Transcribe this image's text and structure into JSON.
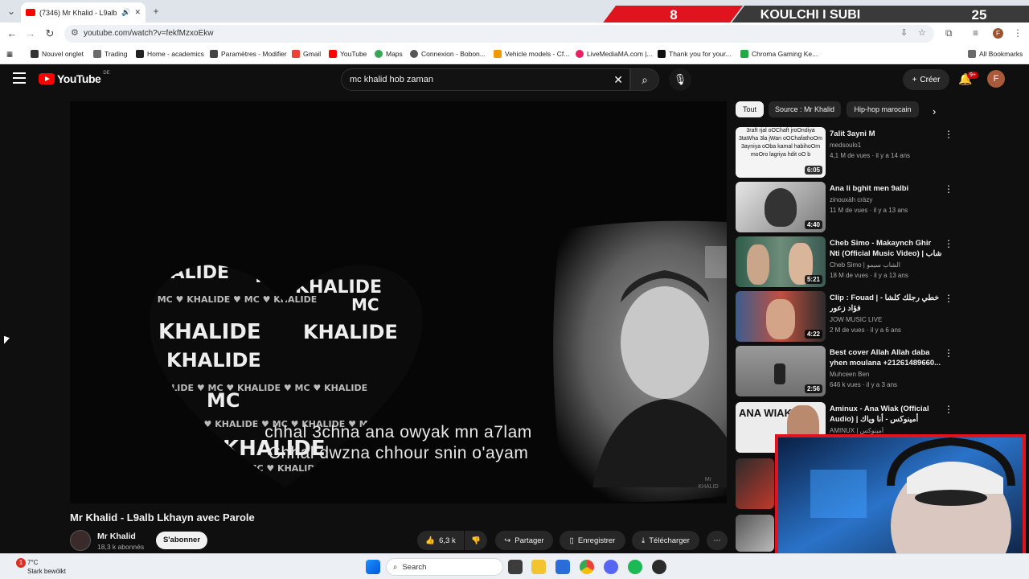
{
  "browser": {
    "tab_title": "(7346) Mr Khalid - L9alb Lkh",
    "tab_search_icon": "chevron-down-icon",
    "new_tab_icon": "plus-icon",
    "url": "youtube.com/watch?v=fekfMzxoEkw"
  },
  "stream_overlay": {
    "score_left": "8",
    "title": "KOULCHI I SUBI",
    "score_right": "25",
    "colors": {
      "red": "#e0141e",
      "dark": "#3a3a3a"
    }
  },
  "bookmarks": [
    {
      "label": "Nouvel onglet",
      "color": "#333333"
    },
    {
      "label": "Trading",
      "color": "#6b6b6b"
    },
    {
      "label": "Home - academics",
      "color": "#222222"
    },
    {
      "label": "Paramètres - Modifier",
      "color": "#444444"
    },
    {
      "label": "Gmail",
      "color": "#ea4335"
    },
    {
      "label": "YouTube",
      "color": "#ff0000"
    },
    {
      "label": "Maps",
      "color": "#34a853"
    },
    {
      "label": "Connexion - Bobon...",
      "color": "#555555"
    },
    {
      "label": "Vehicle models - Cf...",
      "color": "#f29900"
    },
    {
      "label": "LiveMediaMA.com |...",
      "color": "#e91e63"
    },
    {
      "label": "Thank you for your...",
      "color": "#111111"
    },
    {
      "label": "Chroma Gaming Ke...",
      "color": "#22aa44"
    }
  ],
  "all_bookmarks": "All Bookmarks",
  "youtube": {
    "logo_text": "YouTube",
    "region": "DE",
    "search_query": "mc khalid hob zaman",
    "create_label": "Créer",
    "notif_badge": "9+",
    "avatar_letter": "F"
  },
  "video": {
    "lyric_line1": "chhal 3chna ana owyak mn a7lam",
    "lyric_line2": "Chhal dwzna chhour snin o'ayam",
    "watermark_line1": "Mr",
    "watermark_line2": "KHALID",
    "heart_words": [
      "KHALIDE",
      "MC",
      "KHALIDE",
      "MC",
      "KHALIDE",
      "KHALIDE",
      "KHALIDE",
      "MC",
      "KHALIDE"
    ],
    "title": "Mr Khalid - L9alb Lkhayn avec Parole",
    "channel": "Mr Khalid",
    "subscribers": "18,3 k abonnés",
    "subscribe_label": "S'abonner",
    "likes": "6,3 k",
    "share_label": "Partager",
    "save_label": "Enregistrer",
    "download_label": "Télécharger"
  },
  "chips": [
    "Tout",
    "Source : Mr Khalid",
    "Hip-hop marocain"
  ],
  "recommendations": [
    {
      "title": "7alit 3ayni M",
      "channel": "medsoulo1",
      "meta": "4,1 M de vues · il y a 14 ans",
      "duration": "6:05",
      "thumb_text": "3raft rjal oOChaft jroOndiya 3taWha 3la jWan oOChafathoOm 3ayniya oOba kamal habihoOm moOro lagriya hdit oO b",
      "color": "#f4f4f4"
    },
    {
      "title": "Ana li bghit men 9albi",
      "channel": "zinouxàh cràzy",
      "meta": "11 M de vues · il y a 13 ans",
      "duration": "4:40",
      "color": "#dcdcdc"
    },
    {
      "title": "Cheb Simo - Makaynch Ghir Nti (Official Music Video) | شاب سيمو",
      "channel": "Cheb Simo | الشاب سيمو",
      "meta": "18 M de vues · il y a 13 ans",
      "duration": "5:21",
      "color": "#3a6b5a"
    },
    {
      "title": "Clip : Fouad | خطي رجلك كلشا - فؤاد زعور",
      "channel": "JOW MUSIC LIVE",
      "meta": "2 M de vues · il y a 6 ans",
      "duration": "4:22",
      "color": "#b94b3a"
    },
    {
      "title": "Best cover Allah Allah daba yhen moulana +21261489660...",
      "channel": "Muhceen Ben",
      "meta": "646 k vues · il y a 3 ans",
      "duration": "2:56",
      "color": "#8a8a8a"
    },
    {
      "title": "Aminux - Ana Wiak (Official Audio) | أمينوكس - أنا وياك",
      "channel": "AMINUX | أمينوكس",
      "meta": "",
      "duration": "",
      "thumb_text": "ANA WIAK",
      "color": "#e8e8e8"
    }
  ],
  "taskbar": {
    "notif_count": "1",
    "temperature": "7°C",
    "condition": "Stark bewölkt",
    "search_label": "Search"
  }
}
